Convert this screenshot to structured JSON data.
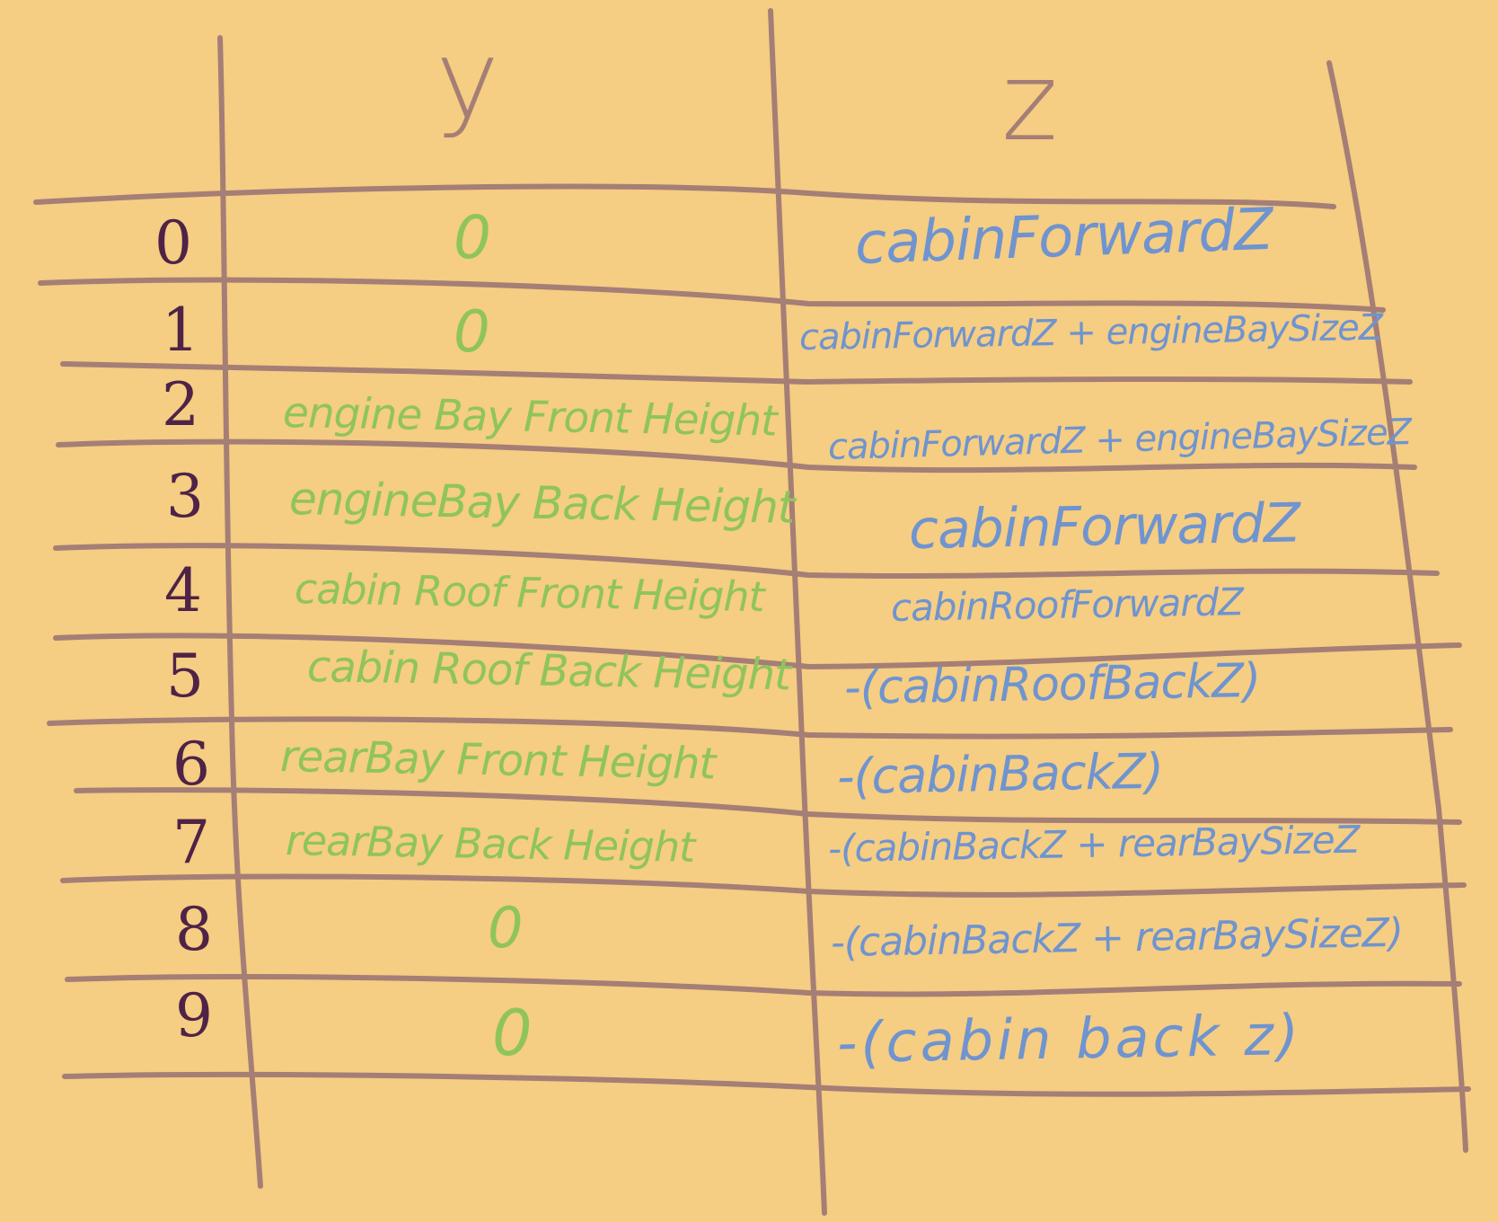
{
  "colors": {
    "paper": "#f5cd83",
    "grid_lines": "#a57e76",
    "index_ink": "#4e2346",
    "y_ink": "#8fc45d",
    "z_ink": "#6f94cf"
  },
  "headers": {
    "y": "y",
    "z": "z"
  },
  "rows": [
    {
      "index": "0",
      "y": "0",
      "z": "cabinForwardZ"
    },
    {
      "index": "1",
      "y": "0",
      "z": "cabinForwardZ + engineBaySizeZ"
    },
    {
      "index": "2",
      "y": "engine Bay Front Height",
      "z": "cabinForwardZ + engineBaySizeZ"
    },
    {
      "index": "3",
      "y": "engineBay Back Height",
      "z": "cabinForwardZ"
    },
    {
      "index": "4",
      "y": "cabin Roof Front Height",
      "z": "cabinRoofForwardZ"
    },
    {
      "index": "5",
      "y": "cabin Roof Back Height",
      "z": "-(cabinRoofBackZ)"
    },
    {
      "index": "6",
      "y": "rearBay Front Height",
      "z": "-(cabinBackZ)"
    },
    {
      "index": "7",
      "y": "rearBay Back Height",
      "z": "-(cabinBackZ + rearBaySizeZ"
    },
    {
      "index": "8",
      "y": "0",
      "z": "-(cabinBackZ + rearBaySizeZ)"
    },
    {
      "index": "9",
      "y": "0",
      "z": "-(cabin back z)"
    }
  ]
}
